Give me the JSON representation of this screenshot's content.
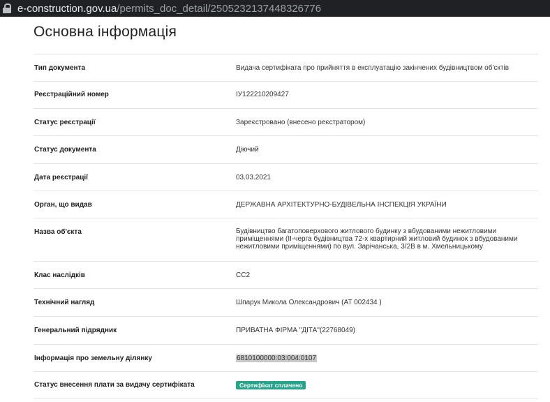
{
  "browser": {
    "url_host": "e-construction.gov.ua",
    "url_path": "/permits_doc_detail/2505232137448326776"
  },
  "page": {
    "heading": "Основна інформація"
  },
  "rows": [
    {
      "label": "Тип документа",
      "value": "Видача сертифіката про прийняття в експлуатацію закінчених будівництвом об'єктів"
    },
    {
      "label": "Реєстраційний номер",
      "value": "ІУ122210209427"
    },
    {
      "label": "Статус реєстрації",
      "value": "Зареєстровано (внесено реєстратором)"
    },
    {
      "label": "Статус документа",
      "value": "Діючий"
    },
    {
      "label": "Дата реєстрації",
      "value": "03.03.2021"
    },
    {
      "label": "Орган, що видав",
      "value": "ДЕРЖАВНА АРХІТЕКТУРНО-БУДІВЕЛЬНА ІНСПЕКЦІЯ УКРАЇНИ"
    },
    {
      "label": "Назва об'єкта",
      "value": "Будівництво багатоповерхового житлового будинку з вбудованими нежитловими приміщеннями (ІІ-черга будівництва 72-х квартирний житловий будинок з вбудованими нежитловими приміщеннями) по вул. Зарічанська, 3/2В в м. Хмельницькому"
    },
    {
      "label": "Клас наслідків",
      "value": "СС2"
    },
    {
      "label": "Технічний нагляд",
      "value": "Шпарук Микола Олександрович (АТ 002434 )"
    },
    {
      "label": "Генеральний підрядник",
      "value": "ПРИВАТНА ФІРМА \"ДІТА\"(22768049)"
    },
    {
      "label": "Інформація про земельну ділянку",
      "value": "6810100000:03:004:0107"
    },
    {
      "label": "Статус внесення плати за видачу сертифіката",
      "value": "Сертифікат сплачено"
    }
  ],
  "colors": {
    "badge": "#27a38a",
    "browser_bar": "#202124"
  }
}
